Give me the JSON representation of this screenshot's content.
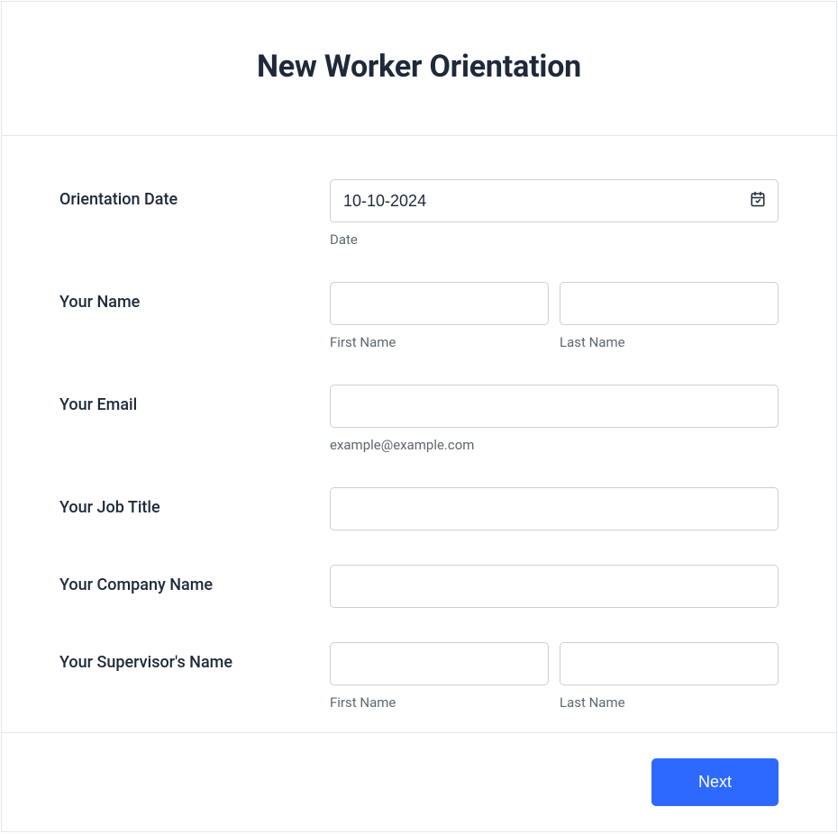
{
  "header": {
    "title": "New Worker Orientation"
  },
  "form": {
    "orientation_date": {
      "label": "Orientation Date",
      "value": "10-10-2024",
      "sublabel": "Date"
    },
    "your_name": {
      "label": "Your Name",
      "first_value": "",
      "last_value": "",
      "first_sublabel": "First Name",
      "last_sublabel": "Last Name"
    },
    "your_email": {
      "label": "Your Email",
      "value": "",
      "sublabel": "example@example.com"
    },
    "job_title": {
      "label": "Your Job Title",
      "value": ""
    },
    "company_name": {
      "label": "Your Company Name",
      "value": ""
    },
    "supervisor_name": {
      "label": "Your Supervisor's Name",
      "first_value": "",
      "last_value": "",
      "first_sublabel": "First Name",
      "last_sublabel": "Last Name"
    }
  },
  "footer": {
    "next_label": "Next"
  }
}
